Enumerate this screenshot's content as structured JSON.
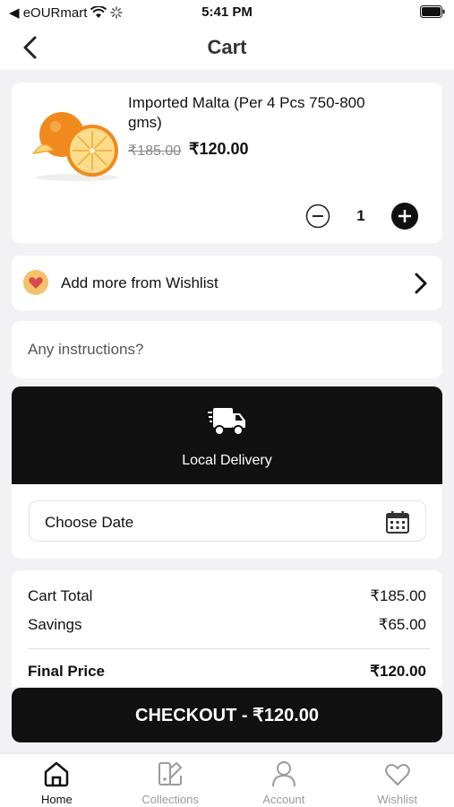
{
  "status_bar": {
    "carrier": "◀ eOURmart",
    "time": "5:41 PM"
  },
  "nav": {
    "title": "Cart"
  },
  "cart_item": {
    "name": "Imported Malta (Per 4 Pcs 750-800 gms)",
    "original_price": "₹185.00",
    "price": "₹120.00",
    "quantity": "1"
  },
  "wishlist": {
    "label": "Add more from Wishlist"
  },
  "instructions": {
    "placeholder": "Any instructions?"
  },
  "delivery": {
    "label": "Local Delivery",
    "date_label": "Choose Date"
  },
  "summary": {
    "cart_total_label": "Cart Total",
    "cart_total_value": "₹185.00",
    "savings_label": "Savings",
    "savings_value": "₹65.00",
    "final_label": "Final Price",
    "final_value": "₹120.00"
  },
  "checkout": {
    "label": "CHECKOUT - ₹120.00"
  },
  "tabs": [
    {
      "label": "Home",
      "icon": "home-icon",
      "active": true
    },
    {
      "label": "Collections",
      "icon": "collections-icon",
      "active": false
    },
    {
      "label": "Account",
      "icon": "account-icon",
      "active": false
    },
    {
      "label": "Wishlist",
      "icon": "heart-icon",
      "active": false
    }
  ],
  "colors": {
    "accent": "#111111",
    "muted_text": "#9a9a9a",
    "background": "#f2f2f4",
    "badge": "#f3c26a"
  }
}
